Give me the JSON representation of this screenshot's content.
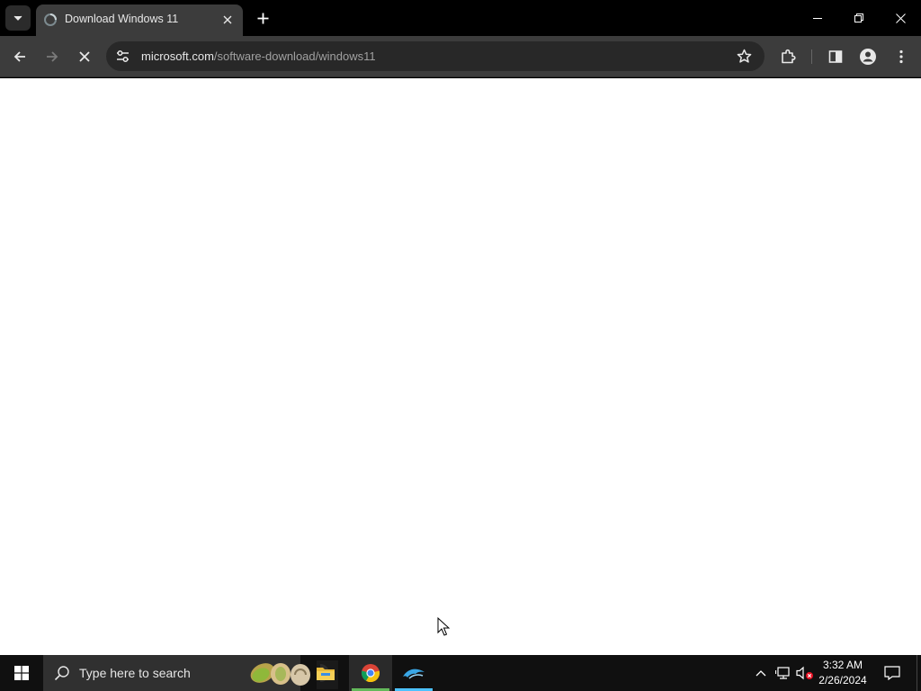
{
  "browser": {
    "tab": {
      "title": "Download Windows 11"
    },
    "address": {
      "host": "microsoft.com",
      "path": "/software-download/windows11"
    },
    "icons": {
      "tab_search": "chevron-down-icon",
      "tab_favicon": "loading-icon",
      "tab_close": "close-icon",
      "new_tab": "plus-icon",
      "back": "arrow-left-icon",
      "forward": "arrow-right-icon",
      "stop": "close-icon",
      "site_info": "tune-icon",
      "bookmark": "star-icon",
      "extensions": "puzzle-icon",
      "side_panel": "side-panel-icon",
      "profile": "person-icon",
      "menu": "kebab-icon"
    }
  },
  "taskbar": {
    "search_placeholder": "Type here to search",
    "apps": [
      "file-explorer",
      "chrome",
      "dolphin"
    ],
    "clock": {
      "time": "3:32 AM",
      "date": "2/26/2024"
    },
    "accent": "#4cc2ff",
    "active_indicator": "#4cc2ff",
    "chrome_indicator": "#63b95a"
  }
}
